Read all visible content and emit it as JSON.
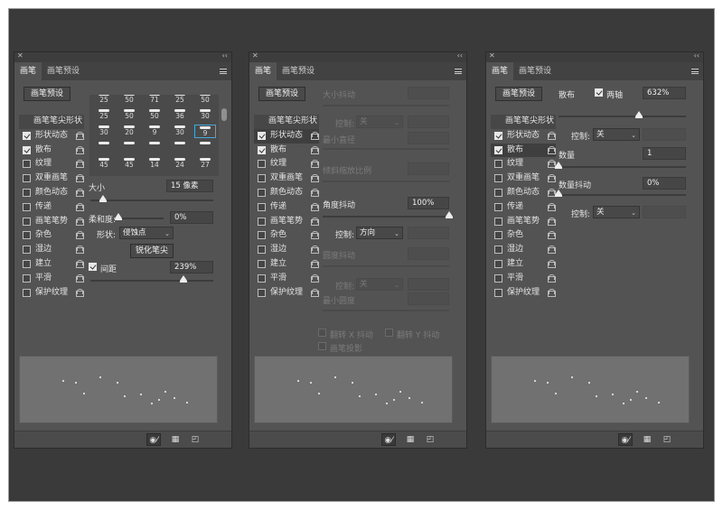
{
  "tabs": {
    "brush": "画笔",
    "brush_preset": "画笔预设"
  },
  "brush_preset_button": "画笔预设",
  "list": [
    {
      "label": "画笔笔尖形状"
    },
    {
      "label": "形状动态"
    },
    {
      "label": "散布"
    },
    {
      "label": "纹理"
    },
    {
      "label": "双重画笔"
    },
    {
      "label": "颜色动态"
    },
    {
      "label": "传递"
    },
    {
      "label": "画笔笔势"
    },
    {
      "label": "杂色"
    },
    {
      "label": "湿边"
    },
    {
      "label": "建立"
    },
    {
      "label": "平滑"
    },
    {
      "label": "保护纹理"
    }
  ],
  "panel1": {
    "brush_grid": [
      [
        "25",
        "50",
        "71",
        "25",
        "50"
      ],
      [
        "25",
        "50",
        "50",
        "36",
        "30"
      ],
      [
        "30",
        "20",
        "9",
        "30",
        "9"
      ],
      [
        "",
        "",
        "",
        "",
        ""
      ],
      [
        "45",
        "45",
        "14",
        "24",
        "27"
      ]
    ],
    "size_label": "大小",
    "size_value": "15 像素",
    "size_pct": 0.1,
    "hardness_label": "柔和度:",
    "hardness_value": "0%",
    "hardness_pct": 0.0,
    "shape_label": "形状:",
    "shape_value": "侵蚀点",
    "sharpen_button": "锐化笔尖",
    "spacing_label": "间距",
    "spacing_value": "239%",
    "spacing_pct": 0.76
  },
  "panel2": {
    "size_jitter": "大小抖动",
    "control_label": "控制:",
    "control_off": "关",
    "min_diameter": "最小直径",
    "tilt_scale": "倾斜缩放比例",
    "angle_jitter": "角度抖动",
    "angle_value": "100%",
    "angle_pct": 1.0,
    "angle_control": "方向",
    "roundness_jitter": "圆度抖动",
    "min_roundness": "最小圆度",
    "flip_x": "翻转 X 抖动",
    "flip_y": "翻转 Y 抖动",
    "brush_projection": "画笔投影"
  },
  "panel3": {
    "scatter_label": "散布",
    "both_axes": "两轴",
    "scatter_value": "632%",
    "scatter_pct": 0.63,
    "control_label": "控制:",
    "control_off": "关",
    "count_label": "数量",
    "count_value": "1",
    "count_pct": 0.0,
    "count_jitter": "数量抖动",
    "count_jitter_value": "0%",
    "count_jitter_pct": 0.0
  },
  "colors": {
    "panel": "#535353",
    "preview": "#717171",
    "selection": "#46a9d8"
  },
  "icons": [
    "close-icon",
    "collapse-icon",
    "panel-menu-icon",
    "lock-icon",
    "toggle-brush-icon",
    "grid-icon",
    "new-brush-icon"
  ]
}
